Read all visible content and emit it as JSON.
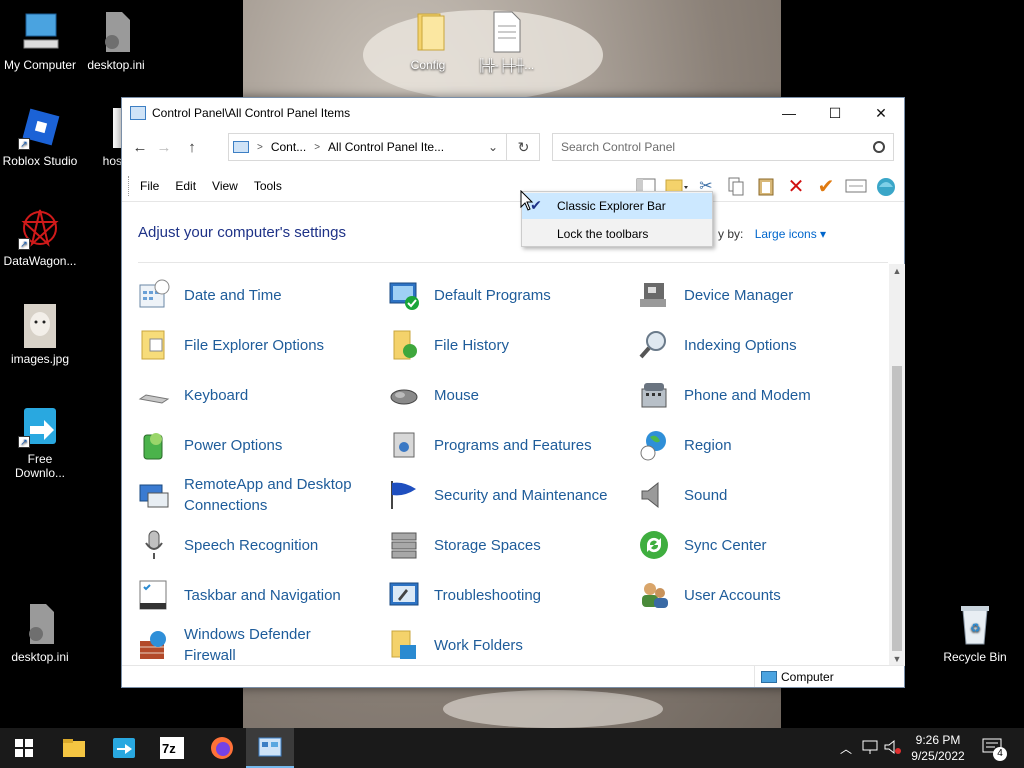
{
  "desktop": {
    "icons": [
      {
        "label": "My Computer"
      },
      {
        "label": "desktop.ini"
      },
      {
        "label": "Config"
      },
      {
        "label": "╠╬-╞╪╫..."
      },
      {
        "label": "Roblox Studio"
      },
      {
        "label": "hos"
      },
      {
        "label": "DataWagon..."
      },
      {
        "label": "images.jpg"
      },
      {
        "label": "Free Downlo..."
      },
      {
        "label": "desktop.ini"
      },
      {
        "label": "Recycle Bin"
      }
    ]
  },
  "window": {
    "title": "Control Panel\\All Control Panel Items",
    "minimize": "—",
    "maximize": "☐",
    "close": "✕",
    "nav": {
      "back": "←",
      "forward": "→",
      "up": "↑"
    },
    "address": {
      "crumb1": "Cont...",
      "crumb2": "All Control Panel Ite...",
      "sep": ">",
      "dropdown": "⌄",
      "refresh": "↻"
    },
    "search": {
      "placeholder": "Search Control Panel"
    },
    "menu": [
      "File",
      "Edit",
      "View",
      "Tools"
    ],
    "heading": "Adjust your computer's settings",
    "view_by": {
      "label": "y by:",
      "value": "Large icons ▾"
    },
    "items": [
      [
        "Date and Time",
        "Default Programs",
        "Device Manager"
      ],
      [
        "File Explorer Options",
        "File History",
        "Indexing Options"
      ],
      [
        "Keyboard",
        "Mouse",
        "Phone and Modem"
      ],
      [
        "Power Options",
        "Programs and Features",
        "Region"
      ],
      [
        "RemoteApp and Desktop Connections",
        "Security and Maintenance",
        "Sound"
      ],
      [
        "Speech Recognition",
        "Storage Spaces",
        "Sync Center"
      ],
      [
        "Taskbar and Navigation",
        "Troubleshooting",
        "User Accounts"
      ],
      [
        "Windows Defender Firewall",
        "Work Folders",
        ""
      ]
    ],
    "status": {
      "computer": "Computer"
    }
  },
  "context_menu": {
    "items": [
      "Classic Explorer Bar",
      "Lock the toolbars"
    ],
    "checked": "✔"
  },
  "taskbar": {
    "time": "9:26 PM",
    "date": "9/25/2022",
    "notifications": "4"
  },
  "colors": {
    "link": "#1e5c9a",
    "heading": "#1e3287",
    "taskbar": "#1a1a1a",
    "menu_highlight": "#cce8ff"
  }
}
